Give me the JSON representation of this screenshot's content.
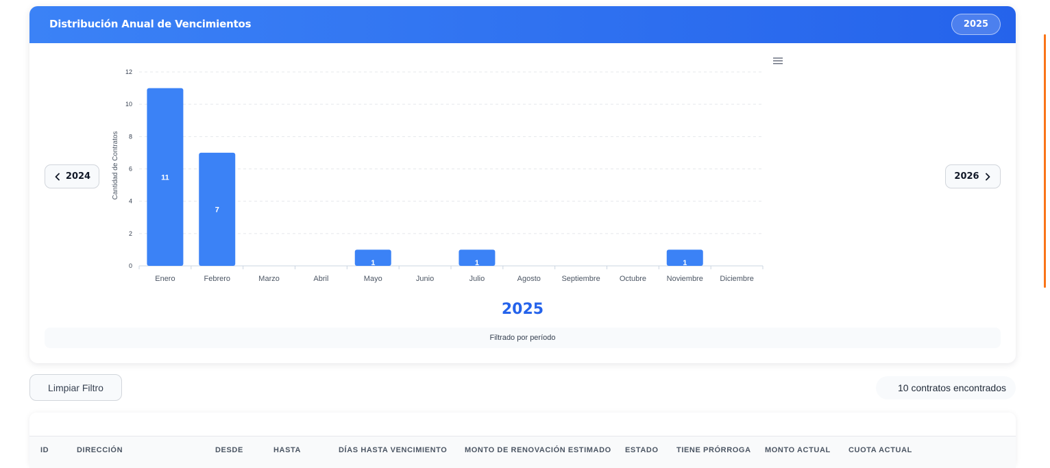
{
  "header": {
    "title": "Distribución Anual de Vencimientos",
    "year_badge": "2025"
  },
  "nav": {
    "prev_label": "2024",
    "next_label": "2026"
  },
  "chart_year": "2025",
  "filter_note": "Filtrado por período",
  "actions": {
    "clear_filter": "Limpiar Filtro",
    "results_count": "10 contratos encontrados"
  },
  "table": {
    "columns": [
      "ID",
      "DIRECCIÓN",
      "DESDE",
      "HASTA",
      "DÍAS HASTA VENCIMIENTO",
      "MONTO DE RENOVACIÓN ESTIMADO",
      "ESTADO",
      "TIENE PRÓRROGA",
      "MONTO ACTUAL",
      "CUOTA ACTUAL"
    ]
  },
  "colors": {
    "accent": "#2563eb",
    "bar": "#3b82f6",
    "scroll_accent": "#f97316"
  },
  "icons": {
    "menu": "hamburger-menu-icon",
    "prev": "chevron-left-icon",
    "next": "chevron-right-icon"
  },
  "chart_data": {
    "type": "bar",
    "categories": [
      "Enero",
      "Febrero",
      "Marzo",
      "Abril",
      "Mayo",
      "Junio",
      "Julio",
      "Agosto",
      "Septiembre",
      "Octubre",
      "Noviembre",
      "Diciembre"
    ],
    "values": [
      11,
      7,
      0,
      0,
      1,
      0,
      1,
      0,
      0,
      0,
      1,
      0
    ],
    "ylabel": "Cantidad de Contratos",
    "xlabel": "",
    "ylim": [
      0,
      12
    ],
    "yticks": [
      0,
      2,
      4,
      6,
      8,
      10,
      12
    ],
    "grid": true
  }
}
